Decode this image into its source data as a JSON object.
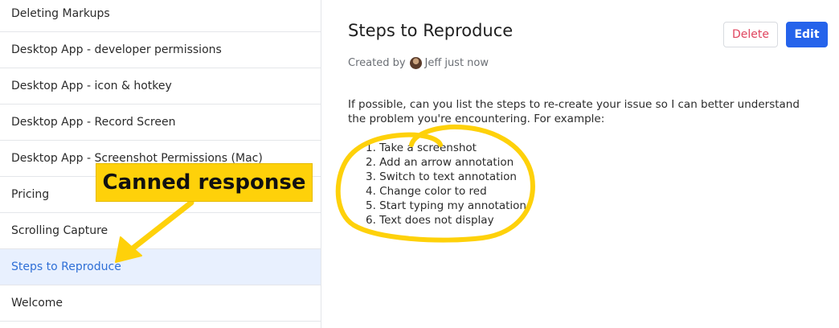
{
  "sidebar": {
    "items": [
      {
        "label": "Deleting Markups",
        "selected": false
      },
      {
        "label": "Desktop App - developer permissions",
        "selected": false
      },
      {
        "label": "Desktop App - icon & hotkey",
        "selected": false
      },
      {
        "label": "Desktop App - Record Screen",
        "selected": false
      },
      {
        "label": "Desktop App - Screenshot Permissions (Mac)",
        "selected": false
      },
      {
        "label": "Pricing",
        "selected": false
      },
      {
        "label": "Scrolling Capture",
        "selected": false
      },
      {
        "label": "Steps to Reproduce",
        "selected": true
      },
      {
        "label": "Welcome",
        "selected": false
      }
    ]
  },
  "article": {
    "title": "Steps to Reproduce",
    "meta_prefix": "Created by",
    "author": "Jeff",
    "time": "just now",
    "delete_label": "Delete",
    "edit_label": "Edit",
    "body": "If possible, can you list the steps to re-create your issue so I can better understand the problem you're encountering. For example:",
    "steps": [
      "1. Take a screenshot",
      "2. Add an arrow annotation",
      "3. Switch to text annotation",
      "4. Change color to red",
      "5. Start typing my annotation",
      "6. Text does not display"
    ]
  },
  "annotation": {
    "callout_text": "Canned response",
    "color": "#fed10a"
  },
  "colors": {
    "selected_bg": "#e8f0fe",
    "selected_text": "#2f6fd6",
    "primary": "#2563eb",
    "danger": "#e0455f"
  }
}
